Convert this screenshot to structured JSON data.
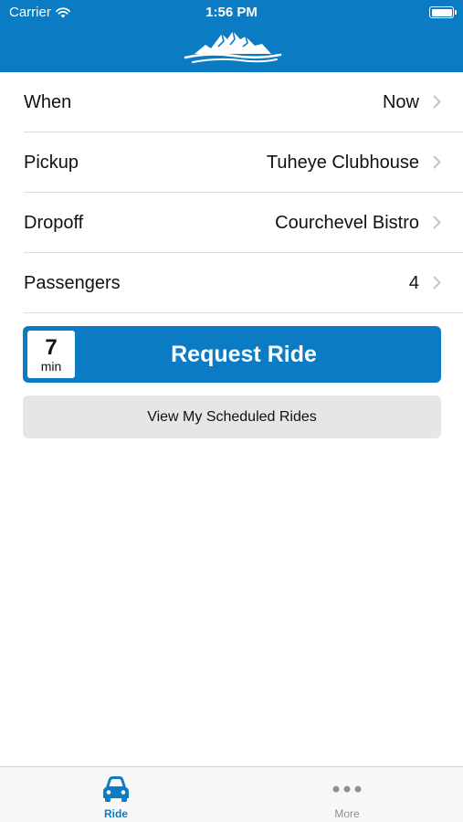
{
  "status_bar": {
    "carrier": "Carrier",
    "time": "1:56 PM"
  },
  "header": {
    "logo_icon": "mountain-logo-icon"
  },
  "rows": [
    {
      "label": "When",
      "value": "Now"
    },
    {
      "label": "Pickup",
      "value": "Tuheye Clubhouse"
    },
    {
      "label": "Dropoff",
      "value": "Courchevel Bistro"
    },
    {
      "label": "Passengers",
      "value": "4"
    }
  ],
  "request": {
    "eta_value": "7",
    "eta_unit": "min",
    "label": "Request Ride"
  },
  "scheduled_button": {
    "label": "View My Scheduled Rides"
  },
  "tabbar": {
    "tabs": [
      {
        "label": "Ride",
        "icon": "car-icon",
        "active": true
      },
      {
        "label": "More",
        "icon": "more-dots-icon",
        "active": false
      }
    ]
  },
  "colors": {
    "accent": "#0b7bc4",
    "secondary_button": "#e6e6e8",
    "inactive_tab": "#8e8e93"
  }
}
